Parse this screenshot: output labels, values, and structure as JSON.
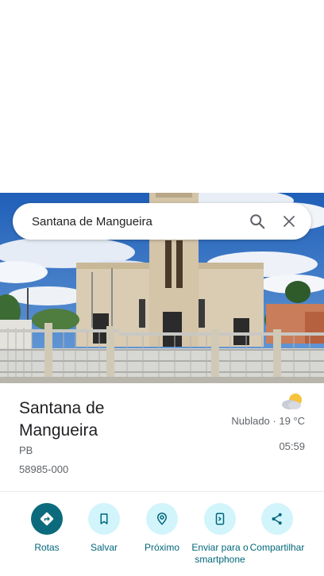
{
  "search": {
    "query": "Santana de Mangueira",
    "search_icon": "search-icon",
    "close_icon": "close-icon"
  },
  "place": {
    "name": "Santana de Mangueira",
    "state": "PB",
    "postal_code": "58985-000"
  },
  "weather": {
    "icon": "partly-cloudy-icon",
    "condition": "Nublado · 19 °C",
    "time": "05:59"
  },
  "actions": [
    {
      "label": "Rotas",
      "icon": "directions-icon"
    },
    {
      "label": "Salvar",
      "icon": "bookmark-icon"
    },
    {
      "label": "Próximo",
      "icon": "nearby-icon"
    },
    {
      "label": "Enviar para o smartphone",
      "icon": "send-to-phone-icon"
    },
    {
      "label": "Compartilhar",
      "icon": "share-icon"
    }
  ],
  "colors": {
    "accent": "#00677a",
    "primary_button": "#0b6b7c",
    "tonal_button": "#d2f4fb"
  }
}
